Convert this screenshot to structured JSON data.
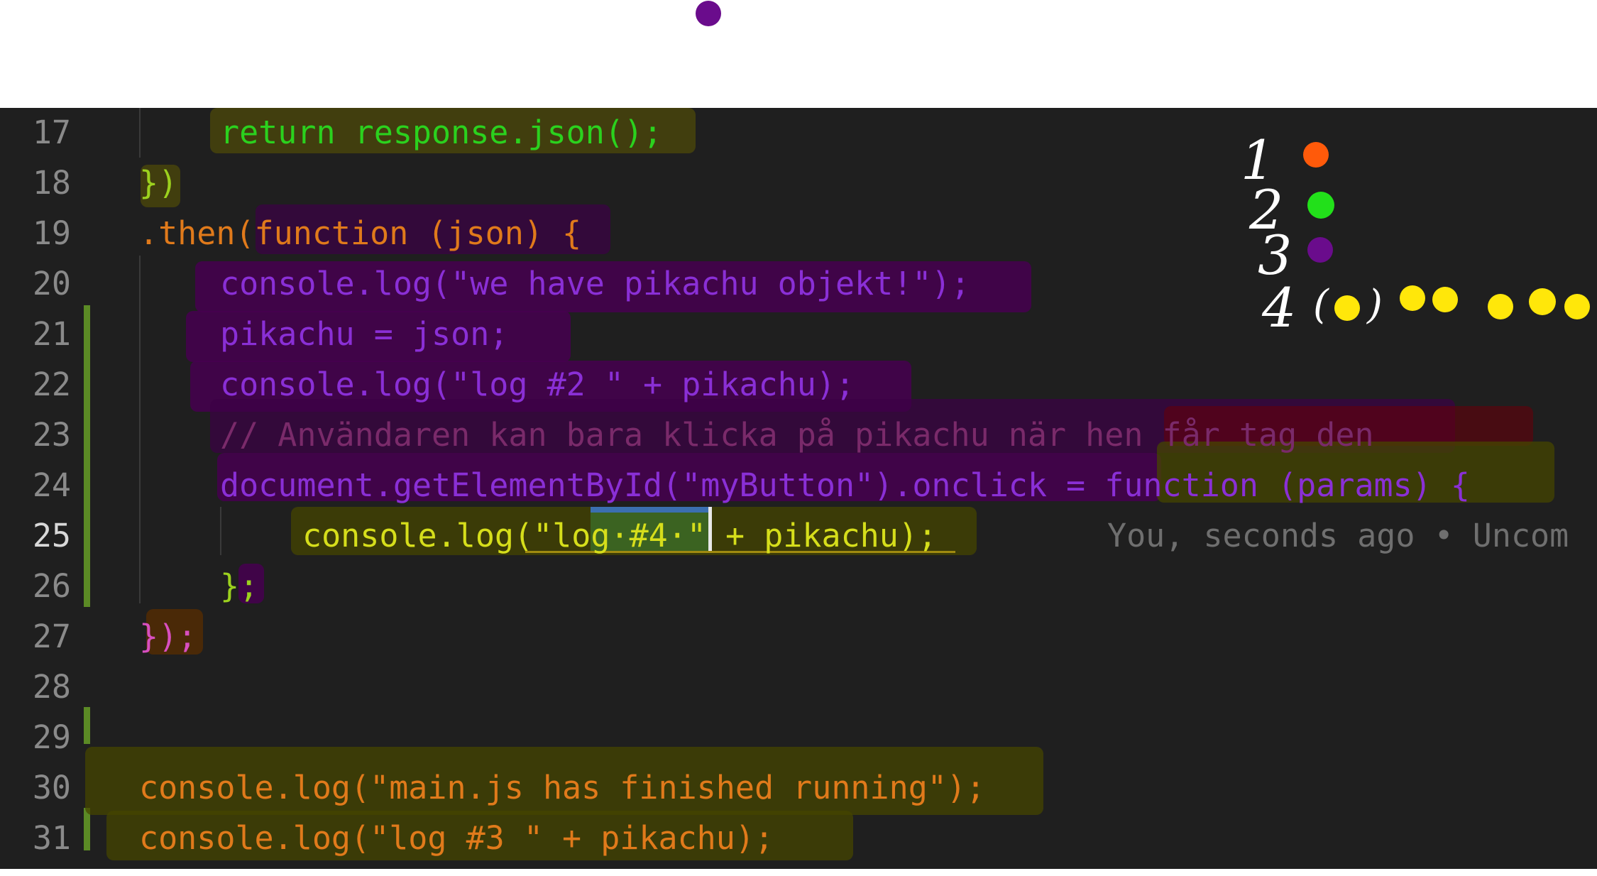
{
  "editor": {
    "lines": [
      {
        "num": "17",
        "text": "return response.json();"
      },
      {
        "num": "18",
        "text": "})"
      },
      {
        "num": "19",
        "text": ".then(function (json) {"
      },
      {
        "num": "20",
        "text": "console.log(\"we have pikachu objekt!\");"
      },
      {
        "num": "21",
        "text": "pikachu = json;"
      },
      {
        "num": "22",
        "text": "console.log(\"log #2 \" + pikachu);"
      },
      {
        "num": "23",
        "text": "// Användaren kan bara klicka på pikachu när hen får tag den"
      },
      {
        "num": "24",
        "text": "document.getElementById(\"myButton\").onclick = function (params) {"
      },
      {
        "num": "25",
        "text": "console.log(\"log·#4·\" + pikachu);"
      },
      {
        "num": "26",
        "text": "};"
      },
      {
        "num": "27",
        "text": "});"
      },
      {
        "num": "28",
        "text": ""
      },
      {
        "num": "29",
        "text": ""
      },
      {
        "num": "30",
        "text": "console.log(\"main.js has finished running\");"
      },
      {
        "num": "31",
        "text": "console.log(\"log #3 \" + pikachu);"
      }
    ],
    "blame": "You, seconds ago • Uncom"
  },
  "annotations": {
    "legend": [
      {
        "label": "1",
        "color": "#ff5a0a"
      },
      {
        "label": "2",
        "color": "#22e01a"
      },
      {
        "label": "3",
        "color": "#6a0c8c"
      },
      {
        "label": "4",
        "color": "#ffe70a"
      }
    ],
    "paren_left": "(",
    "paren_right": ")",
    "top_dot_color": "#6a0c8c"
  }
}
